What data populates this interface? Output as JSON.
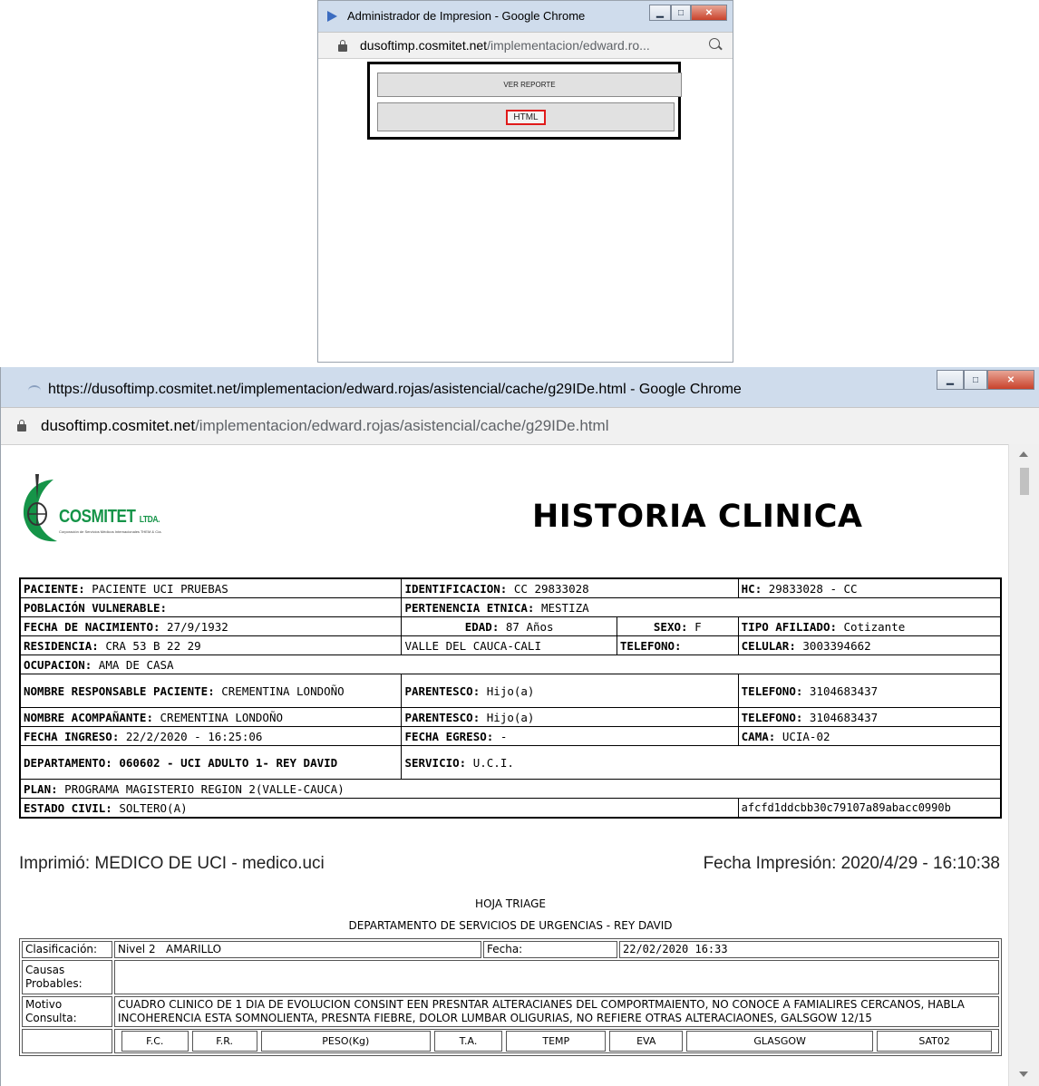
{
  "popup": {
    "window_title": "Administrador de Impresion - Google Chrome",
    "url_domain": "dusoftimp.cosmitet.net",
    "url_path": "/implementacion/edward.ro...",
    "btn_ver_reporte": "VER REPORTE",
    "btn_html": "HTML"
  },
  "main": {
    "window_title": "https://dusoftimp.cosmitet.net/implementacion/edward.rojas/asistencial/cache/g29IDe.html - Google Chrome",
    "url_domain": "dusoftimp.cosmitet.net",
    "url_path": "/implementacion/edward.rojas/asistencial/cache/g29IDe.html",
    "logo_word": "COSMITET",
    "logo_suffix": "LTDA.",
    "logo_sub": "Corporación de Servicios Médicos Internacionales THEM & Cía.",
    "doc_title": "HISTORIA CLINICA"
  },
  "patient": {
    "paciente_l": "PACIENTE:",
    "paciente_v": "PACIENTE UCI PRUEBAS",
    "ident_l": "IDENTIFICACION:",
    "ident_v": "CC 29833028",
    "hc_l": "HC:",
    "hc_v": "29833028 - CC",
    "poblacion_l": "POBLACIÓN VULNERABLE:",
    "etnica_l": "PERTENENCIA ETNICA:",
    "etnica_v": "MESTIZA",
    "nacimiento_l": "FECHA DE NACIMIENTO:",
    "nacimiento_v": "27/9/1932",
    "edad_l": "EDAD:",
    "edad_v": "87 Años",
    "sexo_l": "SEXO:",
    "sexo_v": "F",
    "afiliado_l": "TIPO AFILIADO:",
    "afiliado_v": "Cotizante",
    "residencia_l": "RESIDENCIA:",
    "residencia_v": "CRA 53 B 22 29",
    "ciudad_v": "VALLE DEL CAUCA-CALI",
    "telefono_l": "TELEFONO:",
    "celular_l": "CELULAR:",
    "celular_v": "3003394662",
    "ocupacion_l": "OCUPACION:",
    "ocupacion_v": "AMA DE CASA",
    "responsable_l": "NOMBRE RESPONSABLE PACIENTE:",
    "responsable_v": "CREMENTINA LONDOÑO",
    "parentesco_l": "PARENTESCO:",
    "parentesco_v": "Hijo(a)",
    "tel_resp_l": "TELEFONO:",
    "tel_resp_v": "3104683437",
    "acompanante_l": "NOMBRE ACOMPAÑANTE:",
    "acompanante_v": "CREMENTINA LONDOÑO",
    "parentesco2_l": "PARENTESCO:",
    "parentesco2_v": "Hijo(a)",
    "tel_acomp_l": "TELEFONO:",
    "tel_acomp_v": "3104683437",
    "ingreso_l": "FECHA INGRESO:",
    "ingreso_v": "22/2/2020 - 16:25:06",
    "egreso_l": "FECHA EGRESO:",
    "egreso_v": "-",
    "cama_l": "CAMA:",
    "cama_v": "UCIA-02",
    "depto_l": "DEPARTAMENTO: 060602 - UCI ADULTO 1- REY DAVID",
    "servicio_l": "SERVICIO:",
    "servicio_v": "U.C.I.",
    "plan_l": "PLAN:",
    "plan_v": "PROGRAMA MAGISTERIO REGION 2(VALLE-CAUCA)",
    "civil_l": "ESTADO CIVIL:",
    "civil_v": "SOLTERO(A)",
    "hash_v": "afcfd1ddcbb30c79107a89abacc0990b"
  },
  "print_info": {
    "printed_by": "Imprimió: MEDICO DE UCI - medico.uci",
    "print_date": "Fecha Impresión:  2020/4/29 - 16:10:38"
  },
  "triage": {
    "title": "HOJA TRIAGE",
    "subtitle": "DEPARTAMENTO DE SERVICIOS DE URGENCIAS - REY DAVID",
    "clasificacion_l": "Clasificación:",
    "clasificacion_v": "Nivel 2   AMARILLO",
    "fecha_l": "Fecha:",
    "fecha_v": "22/02/2020 16:33",
    "causas_l": "Causas Probables:",
    "causas_v": "",
    "motivo_l": "Motivo Consulta:",
    "motivo_v": "CUADRO CLINICO DE 1 DIA DE EVOLUCION CONSINT EEN PRESNTAR ALTERACIANES DEL COMPORTMAIENTO, NO CONOCE A FAMIALIRES CERCANOS, HABLA INCOHERENCIA ESTA SOMNOLIENTA, PRESNTA FIEBRE, DOLOR LUMBAR OLIGURIAS, NO REFIERE OTRAS ALTERACIAONES, GALSGOW 12/15",
    "vitals": [
      "F.C.",
      "F.R.",
      "PESO(Kg)",
      "T.A.",
      "TEMP",
      "EVA",
      "GLASGOW",
      "SAT02"
    ]
  }
}
